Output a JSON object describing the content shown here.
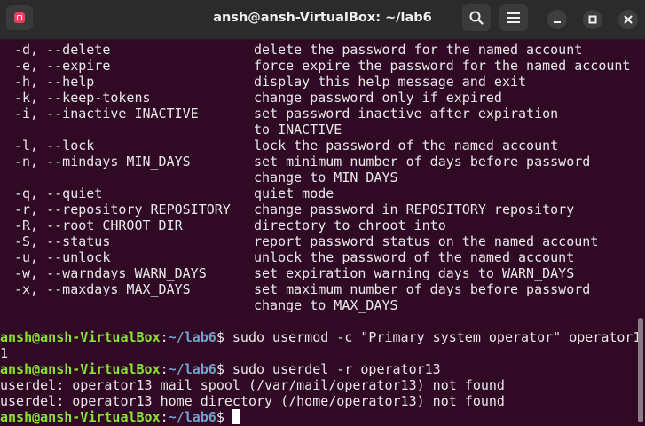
{
  "window": {
    "title": "ansh@ansh-VirtualBox: ~/lab6"
  },
  "toolbar": {
    "new_tab_icon": "terminal-new-tab-icon",
    "search_icon": "search-icon",
    "menu_icon": "hamburger-menu-icon",
    "minimize_icon": "minimize-icon",
    "maximize_icon": "maximize-icon",
    "close_icon": "close-icon"
  },
  "colors": {
    "terminal_bg": "#300a24",
    "titlebar_bg": "#2b2b2b",
    "prompt_user": "#8ae234",
    "prompt_path": "#729fcf",
    "text": "#e8e8e8"
  },
  "help_options": [
    {
      "flag": "-d, --delete",
      "desc": "delete the password for the named account"
    },
    {
      "flag": "-e, --expire",
      "desc": "force expire the password for the named account"
    },
    {
      "flag": "-h, --help",
      "desc": "display this help message and exit"
    },
    {
      "flag": "-k, --keep-tokens",
      "desc": "change password only if expired"
    },
    {
      "flag": "-i, --inactive INACTIVE",
      "desc": "set password inactive after expiration"
    },
    {
      "flag": "",
      "desc": "to INACTIVE"
    },
    {
      "flag": "-l, --lock",
      "desc": "lock the password of the named account"
    },
    {
      "flag": "-n, --mindays MIN_DAYS",
      "desc": "set minimum number of days before password"
    },
    {
      "flag": "",
      "desc": "change to MIN_DAYS"
    },
    {
      "flag": "-q, --quiet",
      "desc": "quiet mode"
    },
    {
      "flag": "-r, --repository REPOSITORY",
      "desc": "change password in REPOSITORY repository"
    },
    {
      "flag": "-R, --root CHROOT_DIR",
      "desc": "directory to chroot into"
    },
    {
      "flag": "-S, --status",
      "desc": "report password status on the named account"
    },
    {
      "flag": "-u, --unlock",
      "desc": "unlock the password of the named account"
    },
    {
      "flag": "-w, --warndays WARN_DAYS",
      "desc": "set expiration warning days to WARN_DAYS"
    },
    {
      "flag": "-x, --maxdays MAX_DAYS",
      "desc": "set maximum number of days before password"
    },
    {
      "flag": "",
      "desc": "change to MAX_DAYS"
    }
  ],
  "session": [
    {
      "kind": "prompt",
      "user": "ansh@ansh-VirtualBox",
      "sep": ":",
      "path": "~/lab6",
      "sign": "$",
      "cmd": " sudo usermod -c \"Primary system operator\" operator1"
    },
    {
      "kind": "output",
      "text": "1"
    },
    {
      "kind": "prompt",
      "user": "ansh@ansh-VirtualBox",
      "sep": ":",
      "path": "~/lab6",
      "sign": "$",
      "cmd": " sudo userdel -r operator13"
    },
    {
      "kind": "output",
      "text": "userdel: operator13 mail spool (/var/mail/operator13) not found"
    },
    {
      "kind": "output",
      "text": "userdel: operator13 home directory (/home/operator13) not found"
    },
    {
      "kind": "prompt",
      "user": "ansh@ansh-VirtualBox",
      "sep": ":",
      "path": "~/lab6",
      "sign": "$",
      "cmd": " ",
      "cursor": true
    }
  ]
}
